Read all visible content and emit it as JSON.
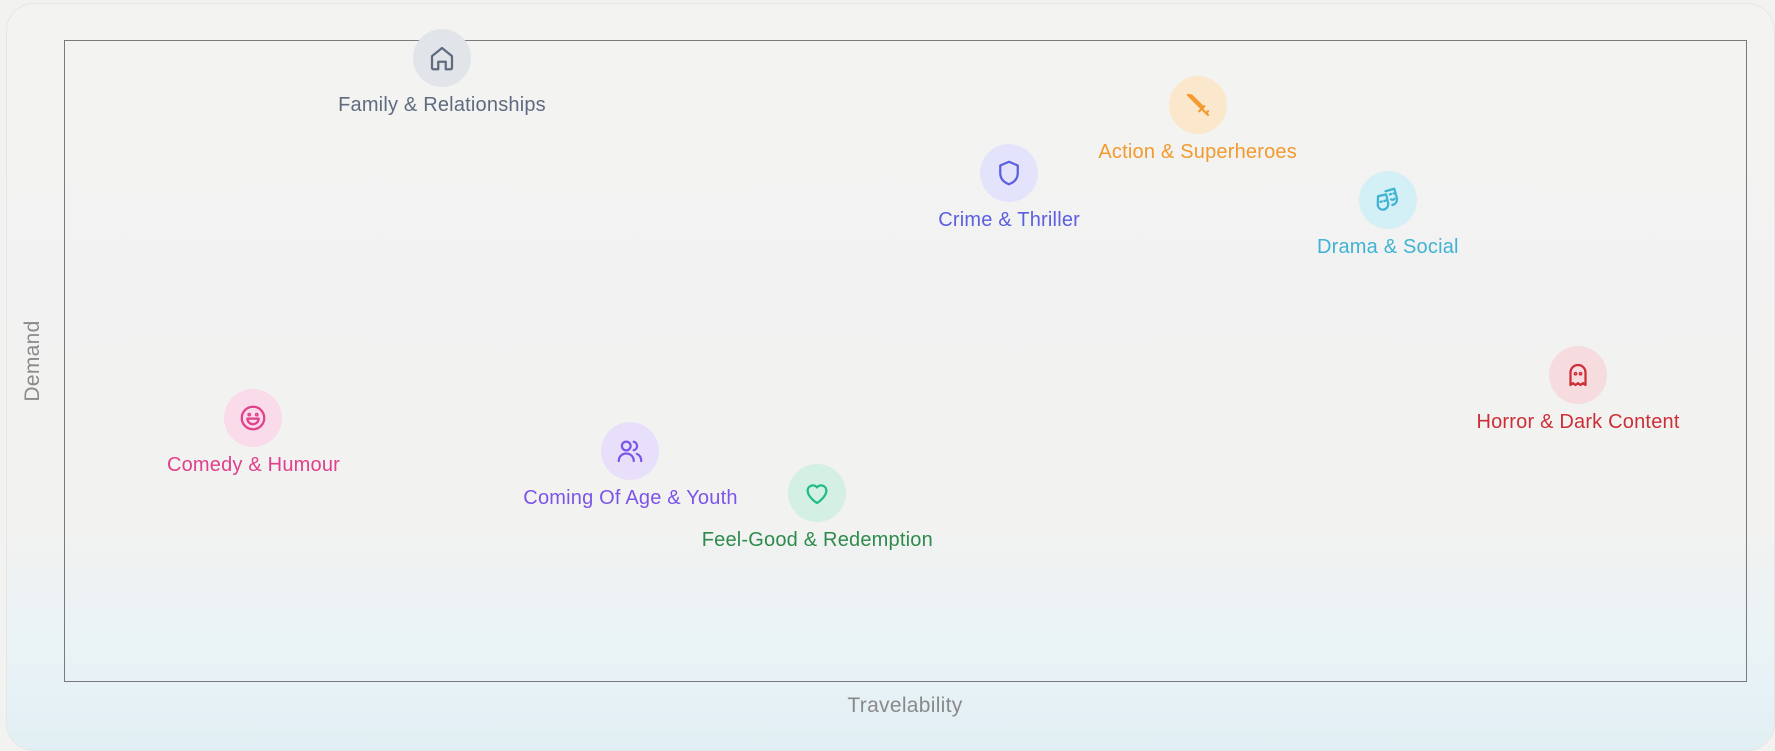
{
  "chart_data": {
    "type": "scatter",
    "xlabel": "Travelability",
    "ylabel": "Demand",
    "xlim": [
      0,
      100
    ],
    "ylim": [
      0,
      100
    ],
    "grid": false,
    "points": [
      {
        "label": "Family & Relationships",
        "x": 22.4,
        "y": 97.3,
        "color": "#5f6b7e",
        "bg": "#e1e4e9",
        "icon": "home-icon"
      },
      {
        "label": "Action & Superheroes",
        "x": 67.3,
        "y": 90.1,
        "color": "#f29a2e",
        "bg": "#fbe8cc",
        "icon": "sword-icon"
      },
      {
        "label": "Crime & Thriller",
        "x": 56.1,
        "y": 79.4,
        "color": "#5b5fe0",
        "bg": "#e3e4fb",
        "icon": "shield-icon"
      },
      {
        "label": "Drama & Social",
        "x": 78.6,
        "y": 75.2,
        "color": "#3fb3d3",
        "bg": "#d3f0f6",
        "icon": "masks-icon"
      },
      {
        "label": "Horror & Dark Content",
        "x": 89.9,
        "y": 48.0,
        "color": "#cc2f37",
        "bg": "#f6dcdf",
        "icon": "ghost-icon"
      },
      {
        "label": "Comedy & Humour",
        "x": 11.2,
        "y": 41.2,
        "color": "#e0408d",
        "bg": "#f9dbe9",
        "icon": "smile-icon"
      },
      {
        "label": "Coming Of Age & Youth",
        "x": 33.6,
        "y": 36.1,
        "color": "#7c55e8",
        "bg": "#e8e0fb",
        "icon": "users-icon"
      },
      {
        "label": "Feel-Good & Redemption",
        "x": 44.7,
        "y": 29.6,
        "color": "#2f8a4c",
        "bg": "#d4efe3",
        "icon": "heart-icon",
        "icon_color": "#1fbd83"
      }
    ]
  }
}
